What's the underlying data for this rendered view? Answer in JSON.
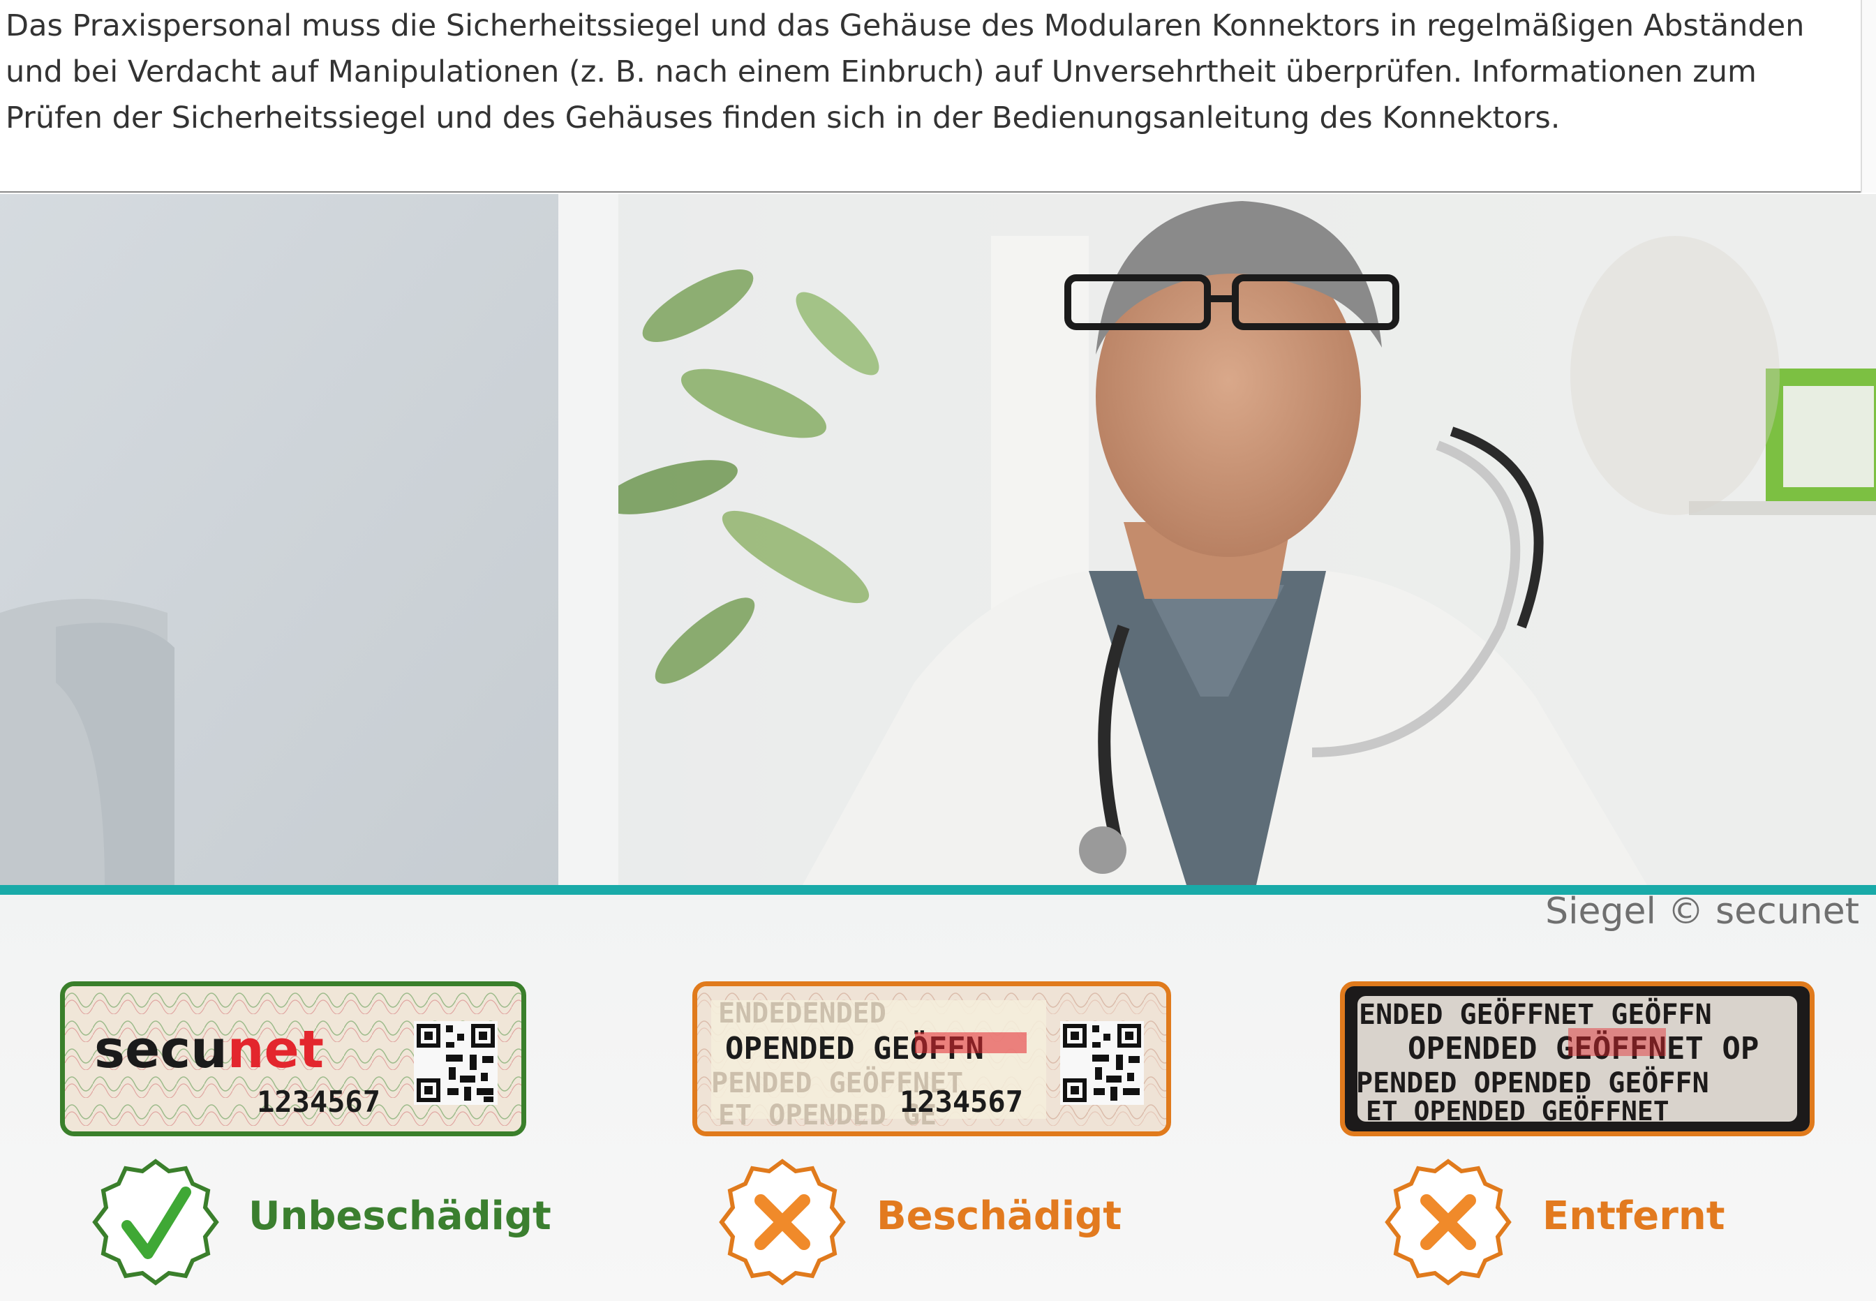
{
  "intro": {
    "text": "Das Praxispersonal muss die Sicherheitssiegel und das Gehäuse des Modularen Konnektors in regelmäßigen Abständen und bei Verdacht auf Manipulationen (z. B. nach einem Einbruch) auf Unversehrtheit überprüfen. Informationen zum Prüfen der Sicherheitssiegel und des Gehäuses finden sich in der Bedienungsanleitung des Konnektors."
  },
  "credit": "Siegel © secunet",
  "seals": [
    {
      "brand_part1": "secu",
      "brand_part2": "net",
      "number": "1234567",
      "status": "Unbeschädigt",
      "icon": "checkmark-icon",
      "color": "#3a7f2b"
    },
    {
      "overprint_line1": "ENDEDENDED",
      "overprint_line2": "OPENDED GEÖFFN",
      "overprint_line3": "PENDED GEÖFFNET",
      "overprint_line4": "ET OPENDED GE",
      "number": "1234567",
      "status": "Beschädigt",
      "icon": "cross-icon",
      "color": "#e07a1c"
    },
    {
      "overprint_line1": "ENDED GEÖFFNET GEÖFFN",
      "overprint_line2": "OPENDED GEÖFFNET OP",
      "overprint_line3": "PENDED OPENDED GEÖFFN",
      "overprint_line4": "ET OPENDED GEÖFFNET",
      "status": "Entfernt",
      "icon": "cross-icon",
      "color": "#e07a1c"
    }
  ],
  "colors": {
    "teal": "#19aaa8",
    "green": "#3a7f2b",
    "orange": "#e07a1c",
    "brand_red": "#e3262d"
  }
}
